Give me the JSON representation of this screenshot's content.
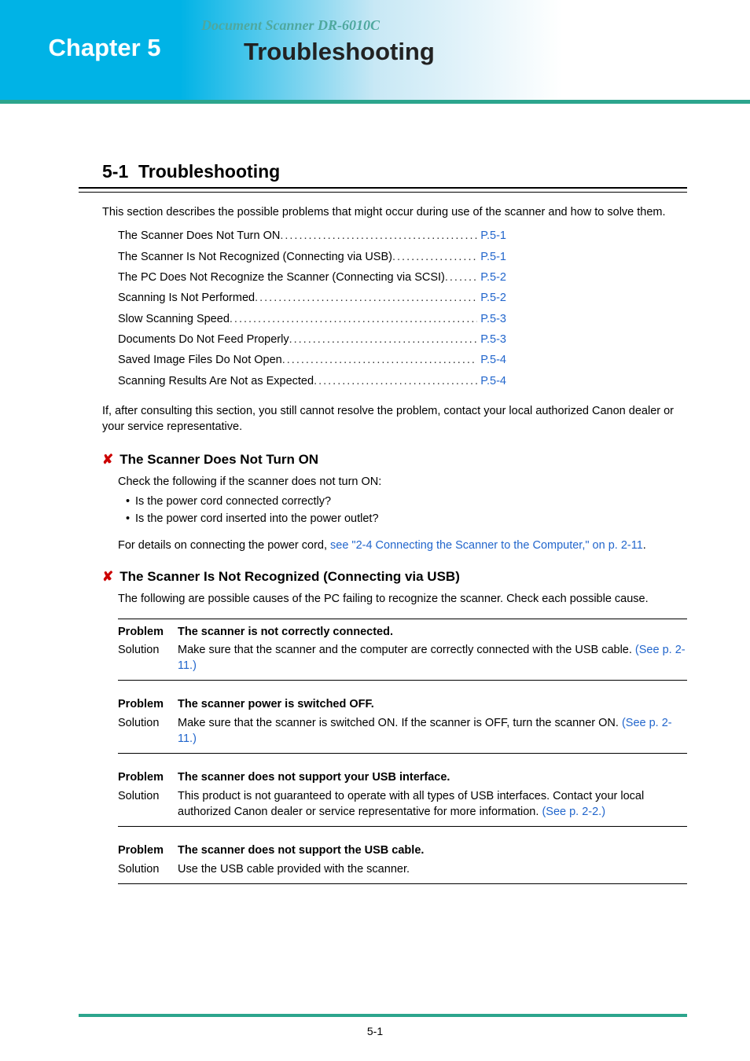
{
  "header": {
    "chapter_label": "Chapter 5",
    "doc_title": "Document Scanner DR-6010C",
    "chapter_title": "Troubleshooting"
  },
  "section": {
    "number": "5-1",
    "title": "Troubleshooting",
    "intro": "This section describes the possible problems that might occur during use of the scanner and how to solve them.",
    "toc": [
      {
        "text": "The Scanner Does Not Turn ON",
        "page": "P.5-1"
      },
      {
        "text": "The Scanner Is Not Recognized (Connecting via USB)",
        "page": "P.5-1"
      },
      {
        "text": "The PC Does Not Recognize the Scanner (Connecting via SCSI)",
        "page": "P.5-2"
      },
      {
        "text": "Scanning Is Not Performed",
        "page": "P.5-2"
      },
      {
        "text": "Slow Scanning Speed",
        "page": "P.5-3"
      },
      {
        "text": "Documents Do Not Feed Properly",
        "page": "P.5-3"
      },
      {
        "text": "Saved Image Files Do Not Open",
        "page": "P.5-4"
      },
      {
        "text": "Scanning Results Are Not as Expected",
        "page": "P.5-4"
      }
    ],
    "followup": "If, after consulting this section, you still cannot resolve the problem, contact your local authorized Canon dealer or your service representative."
  },
  "sub1": {
    "title": "The Scanner Does Not Turn ON",
    "intro": "Check the following if the scanner does not turn ON:",
    "bullets": [
      "Is the power cord connected correctly?",
      "Is the power cord inserted into the power outlet?"
    ],
    "detail_prefix": "For details on connecting the power cord, ",
    "detail_link": "see \"2-4 Connecting the Scanner to the Computer,\" on p. 2-11",
    "detail_suffix": "."
  },
  "sub2": {
    "title": "The Scanner Is Not Recognized (Connecting via USB)",
    "intro": "The following are possible causes of the PC failing to recognize the scanner. Check each possible cause.",
    "items": [
      {
        "problem": "The scanner is not correctly connected.",
        "solution": "Make sure that the scanner and the computer are correctly connected with the USB cable. ",
        "link": "(See p. 2-11.)"
      },
      {
        "problem": "The scanner power is switched OFF.",
        "solution": "Make sure that the scanner is switched ON. If the scanner is OFF, turn the scanner ON. ",
        "link": "(See p. 2-11.)"
      },
      {
        "problem": "The scanner does not support your USB interface.",
        "solution": "This product is not guaranteed to operate with all types of USB interfaces. Contact your local authorized Canon dealer or service representative for more information. ",
        "link": "(See p. 2-2.)"
      },
      {
        "problem": "The scanner does not support the USB cable.",
        "solution": "Use the USB cable provided with the scanner.",
        "link": ""
      }
    ]
  },
  "labels": {
    "problem": "Problem",
    "solution": "Solution"
  },
  "page_number": "5-1"
}
